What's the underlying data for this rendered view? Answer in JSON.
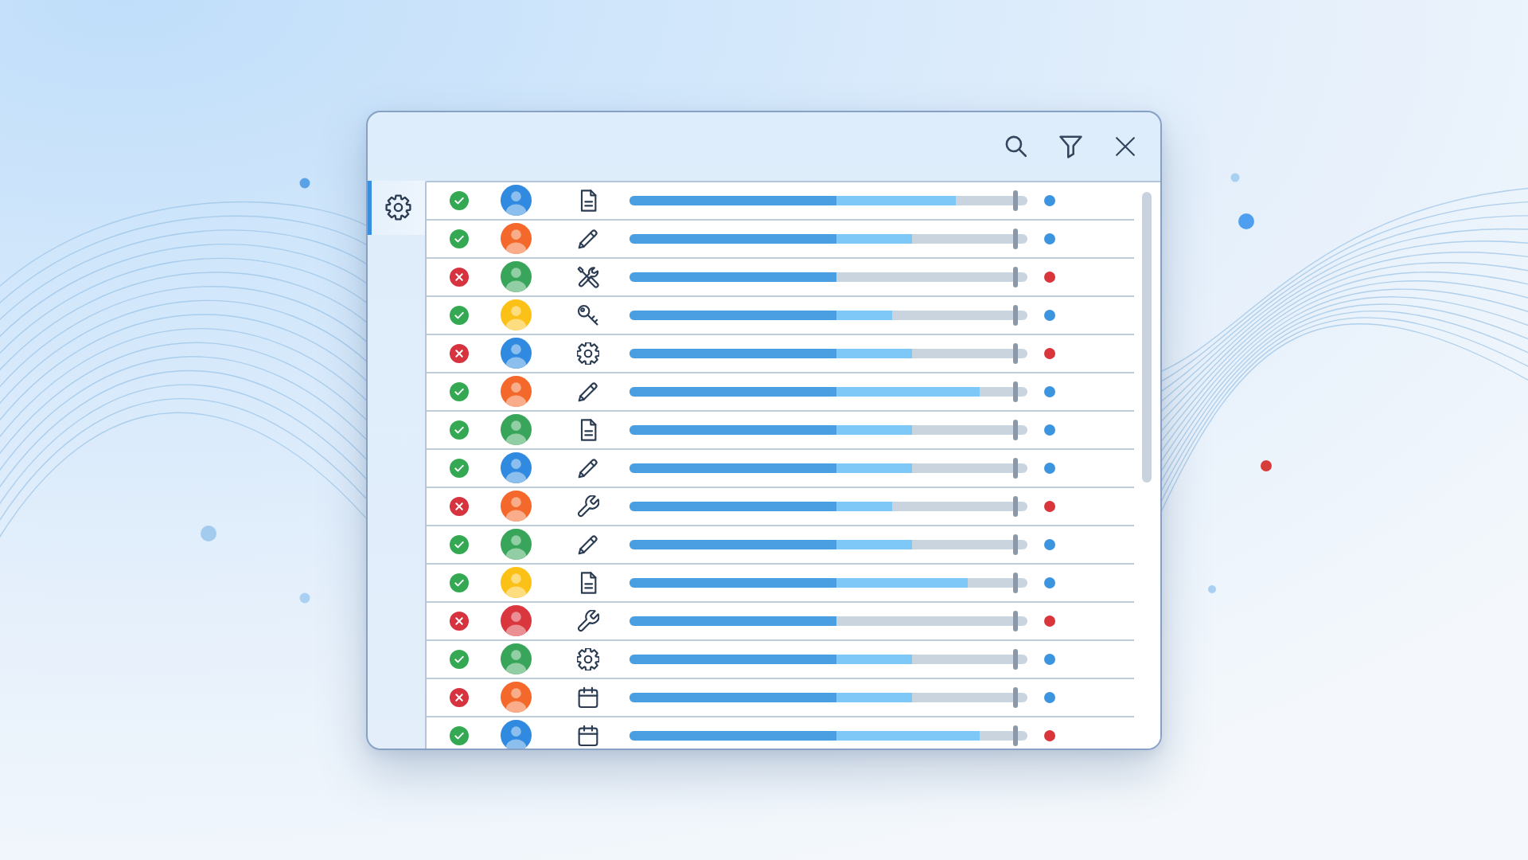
{
  "sidebar": {
    "items": [
      {
        "selected": true
      }
    ]
  },
  "rows": [
    {
      "kind": "document",
      "passed": true,
      "avatar": {
        "color": "#2f8ae0"
      },
      "progress": {
        "level": 0.52
      },
      "buffer": {
        "level": 0.82
      },
      "marker": {
        "level": 0.97
      },
      "dot": {
        "color": "#3d95e0"
      }
    },
    {
      "kind": "pencil",
      "passed": true,
      "avatar": {
        "color": "#f4692b"
      },
      "progress": {
        "level": 0.52
      },
      "buffer": {
        "level": 0.71
      },
      "marker": {
        "level": 0.97
      },
      "dot": {
        "color": "#3d95e0"
      }
    },
    {
      "kind": "tools",
      "passed": false,
      "avatar": {
        "color": "#38a55a"
      },
      "progress": {
        "level": 0.52
      },
      "marker": {
        "level": 0.97
      },
      "dot": {
        "color": "#d8363c"
      }
    },
    {
      "kind": "key",
      "passed": true,
      "avatar": {
        "color": "#fbc116"
      },
      "progress": {
        "level": 0.52
      },
      "buffer": {
        "level": 0.66
      },
      "marker": {
        "level": 0.97
      },
      "dot": {
        "color": "#3d95e0"
      }
    },
    {
      "kind": "gear",
      "passed": false,
      "avatar": {
        "color": "#2f8ae0"
      },
      "progress": {
        "level": 0.52
      },
      "buffer": {
        "level": 0.71
      },
      "marker": {
        "level": 0.97
      },
      "dot": {
        "color": "#d8363c"
      }
    },
    {
      "kind": "pencil",
      "passed": true,
      "avatar": {
        "color": "#f4692b"
      },
      "progress": {
        "level": 0.52
      },
      "buffer": {
        "level": 0.88
      },
      "marker": {
        "level": 0.97
      },
      "dot": {
        "color": "#3d95e0"
      }
    },
    {
      "kind": "document",
      "passed": true,
      "avatar": {
        "color": "#38a55a"
      },
      "progress": {
        "level": 0.52
      },
      "buffer": {
        "level": 0.71
      },
      "marker": {
        "level": 0.97
      },
      "dot": {
        "color": "#3d95e0"
      }
    },
    {
      "kind": "pencil",
      "passed": true,
      "avatar": {
        "color": "#2f8ae0"
      },
      "progress": {
        "level": 0.52
      },
      "buffer": {
        "level": 0.71
      },
      "marker": {
        "level": 0.97
      },
      "dot": {
        "color": "#3d95e0"
      }
    },
    {
      "kind": "wrench",
      "passed": false,
      "avatar": {
        "color": "#f4692b"
      },
      "progress": {
        "level": 0.52
      },
      "buffer": {
        "level": 0.66
      },
      "marker": {
        "level": 0.97
      },
      "dot": {
        "color": "#d8363c"
      }
    },
    {
      "kind": "pencil",
      "passed": true,
      "avatar": {
        "color": "#38a55a"
      },
      "progress": {
        "level": 0.52
      },
      "buffer": {
        "level": 0.71
      },
      "marker": {
        "level": 0.97
      },
      "dot": {
        "color": "#3d95e0"
      }
    },
    {
      "kind": "document",
      "passed": true,
      "avatar": {
        "color": "#fbc116"
      },
      "progress": {
        "level": 0.52
      },
      "buffer": {
        "level": 0.85
      },
      "marker": {
        "level": 0.97
      },
      "dot": {
        "color": "#3d95e0"
      }
    },
    {
      "kind": "wrench",
      "passed": false,
      "avatar": {
        "color": "#d9363e"
      },
      "progress": {
        "level": 0.52
      },
      "marker": {
        "level": 0.97
      },
      "dot": {
        "color": "#d8363c"
      }
    },
    {
      "kind": "gear",
      "passed": true,
      "avatar": {
        "color": "#38a55a"
      },
      "progress": {
        "level": 0.52
      },
      "buffer": {
        "level": 0.71
      },
      "marker": {
        "level": 0.97
      },
      "dot": {
        "color": "#3d95e0"
      }
    },
    {
      "kind": "calendar",
      "passed": false,
      "avatar": {
        "color": "#f4692b"
      },
      "progress": {
        "level": 0.52
      },
      "buffer": {
        "level": 0.71
      },
      "marker": {
        "level": 0.97
      },
      "dot": {
        "color": "#3d95e0"
      }
    },
    {
      "kind": "calendar",
      "passed": true,
      "avatar": {
        "color": "#2f8ae0"
      },
      "progress": {
        "level": 0.52
      },
      "buffer": {
        "level": 0.88
      },
      "marker": {
        "level": 0.97
      },
      "dot": {
        "color": "#d8363c"
      }
    }
  ]
}
